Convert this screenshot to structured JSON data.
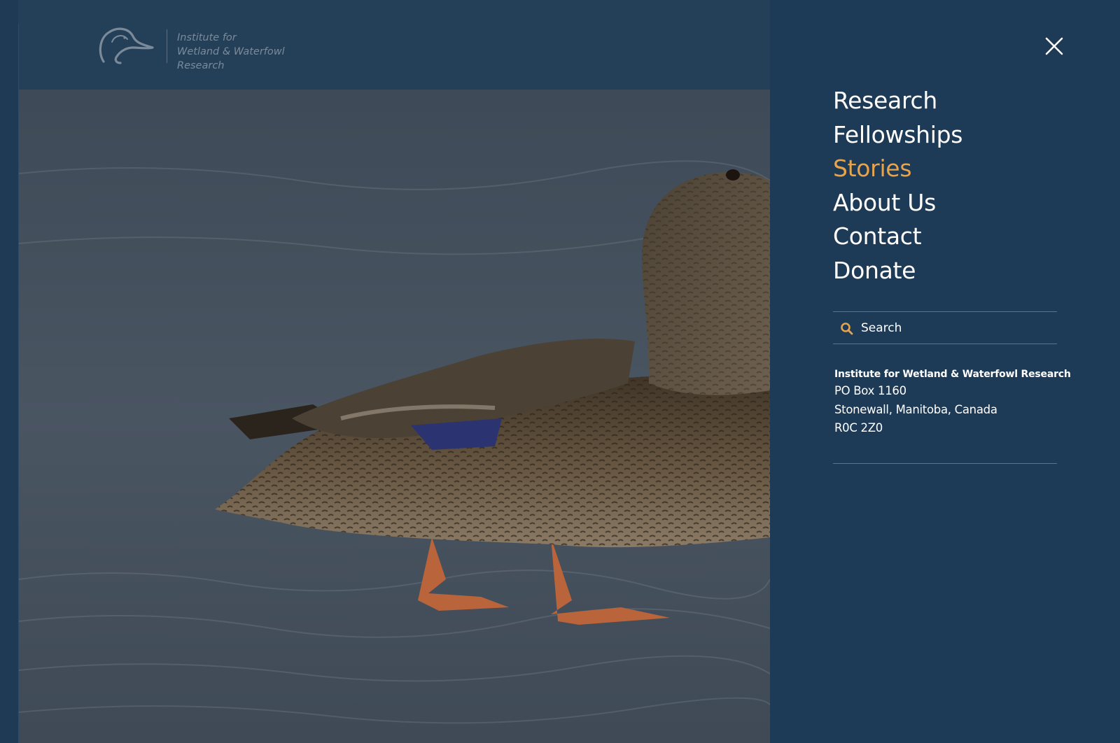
{
  "brand": {
    "line1": "Institute for",
    "line2": "Wetland & Waterfowl Research"
  },
  "menu": {
    "items": [
      {
        "label": "Research",
        "active": false
      },
      {
        "label": "Fellowships",
        "active": false
      },
      {
        "label": "Stories",
        "active": true
      },
      {
        "label": "About Us",
        "active": false
      },
      {
        "label": "Contact",
        "active": false
      },
      {
        "label": "Donate",
        "active": false
      }
    ],
    "close_icon": "close-icon"
  },
  "search": {
    "placeholder": "Search",
    "value": "",
    "icon": "search-icon"
  },
  "address": {
    "name": "Institute for Wetland & Waterfowl Research",
    "line1": "PO Box 1160",
    "line2": "Stonewall, Manitoba, Canada",
    "line3": "R0C 2Z0"
  },
  "colors": {
    "panel_bg": "#1d3a56",
    "accent": "#e7a44c",
    "text": "#ffffff",
    "divider": "#5b7390"
  },
  "hero": {
    "image": "mallard hen walking on water"
  }
}
